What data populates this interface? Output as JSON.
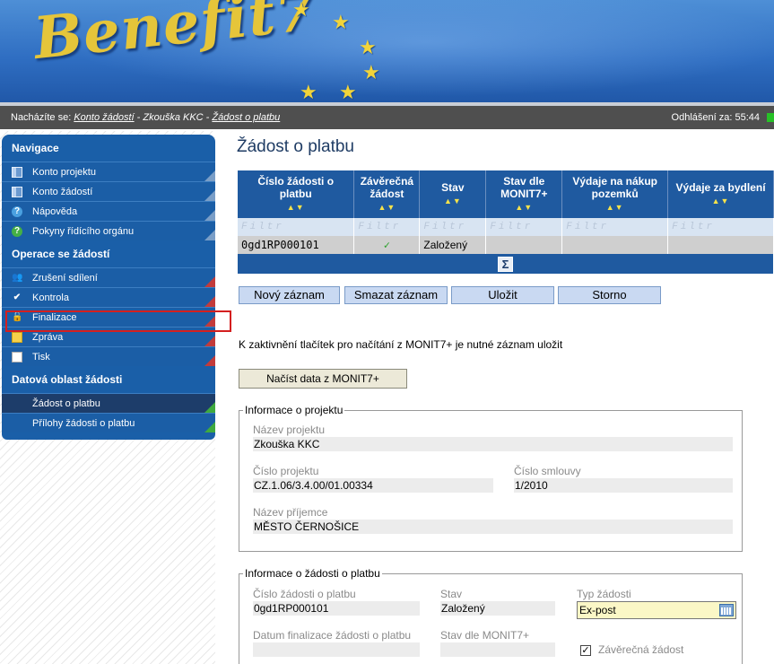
{
  "banner": {
    "logo_text": "Benefit7"
  },
  "location": {
    "prefix": "Nacházíte se:",
    "link": "Konto žádostí",
    "rest_sep1": " - Zkouška KKC - ",
    "current": "Žádost o platbu",
    "logout_label": "Odhlášení za:",
    "logout_time": "55:44"
  },
  "sidebar": {
    "sections": [
      {
        "title": "Navigace"
      },
      {
        "title": "Operace se žádostí"
      },
      {
        "title": "Datová oblast žádosti"
      }
    ],
    "nav": [
      {
        "label": "Konto projektu",
        "icon": "book-icon"
      },
      {
        "label": "Konto žádostí",
        "icon": "book-icon"
      },
      {
        "label": "Nápověda",
        "icon": "help-icon"
      },
      {
        "label": "Pokyny řídícího orgánu",
        "icon": "help-green-icon"
      }
    ],
    "ops": [
      {
        "label": "Zrušení sdílení",
        "icon": "people-icon"
      },
      {
        "label": "Kontrola",
        "icon": "check-icon"
      },
      {
        "label": "Finalizace",
        "icon": "lock-icon"
      },
      {
        "label": "Zpráva",
        "icon": "mail-icon"
      },
      {
        "label": "Tisk",
        "icon": "document-icon"
      }
    ],
    "data": [
      {
        "label": "Žádost o platbu"
      },
      {
        "label": "Přílohy žádosti o platbu"
      }
    ]
  },
  "main": {
    "title": "Žádost o platbu",
    "grid": {
      "columns": [
        "Číslo žádosti o platbu",
        "Závěrečná žádost",
        "Stav",
        "Stav dle MONIT7+",
        "Výdaje na nákup pozemků",
        "Výdaje za bydlení"
      ],
      "filter_placeholder": "Filtr",
      "rows": [
        {
          "cislo": "0gd1RP000101",
          "zaverecna": "✓",
          "stav": "Založený",
          "stav_monit": "",
          "vydaje_pozemky": "",
          "vydaje_bydleni": ""
        }
      ],
      "sum_symbol": "Σ"
    },
    "buttons": {
      "new": "Nový záznam",
      "delete": "Smazat záznam",
      "save": "Uložit",
      "cancel": "Storno"
    },
    "note": "K zaktivnění tlačítek pro načítání z MONIT7+ je nutné záznam uložit",
    "load_button": "Načíst data z MONIT7+",
    "project_info": {
      "legend": "Informace o projektu",
      "name_label": "Název projektu",
      "name_value": "Zkouška KKC",
      "number_label": "Číslo projektu",
      "number_value": "CZ.1.06/3.4.00/01.00334",
      "contract_label": "Číslo smlouvy",
      "contract_value": "1/2010",
      "recipient_label": "Název příjemce",
      "recipient_value": "MĚSTO ČERNOŠICE"
    },
    "request_info": {
      "legend": "Informace o žádosti o platbu",
      "number_label": "Číslo žádosti o platbu",
      "number_value": "0gd1RP000101",
      "state_label": "Stav",
      "state_value": "Založený",
      "type_label": "Typ žádosti",
      "type_value": "Ex-post",
      "final_date_label": "Datum finalizace žádosti o platbu",
      "final_date_value": "",
      "state_monit_label": "Stav dle MONIT7+",
      "state_monit_value": "",
      "final_check_label": "Závěrečná žádost",
      "final_check_value": "✓"
    }
  }
}
